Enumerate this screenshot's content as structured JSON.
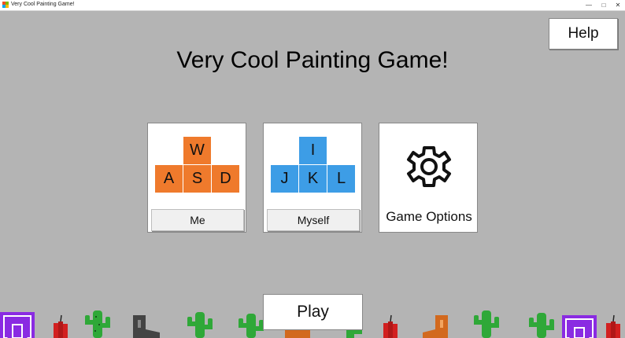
{
  "window": {
    "title": "Very Cool Painting Game!",
    "minimize_glyph": "—",
    "maximize_glyph": "□",
    "close_glyph": "✕"
  },
  "help_label": "Help",
  "game_title": "Very Cool Painting Game!",
  "player_cards": [
    {
      "keys_top": "W",
      "keys_bottom": [
        "A",
        "S",
        "D"
      ],
      "button": "Me",
      "color": "#ef7a2c"
    },
    {
      "keys_top": "I",
      "keys_bottom": [
        "J",
        "K",
        "L"
      ],
      "button": "Myself",
      "color": "#3d9de6"
    }
  ],
  "options_card": {
    "icon": "gear-icon",
    "label": "Game Options"
  },
  "play_label": "Play",
  "colors": {
    "background": "#b4b4b4",
    "orange": "#ef7a2c",
    "blue": "#3d9de6",
    "cactus": "#2fa838",
    "spiral": "#8a2be2",
    "dynamite": "#d22020",
    "boot_gray": "#444444",
    "boot_orange": "#d2691e"
  }
}
